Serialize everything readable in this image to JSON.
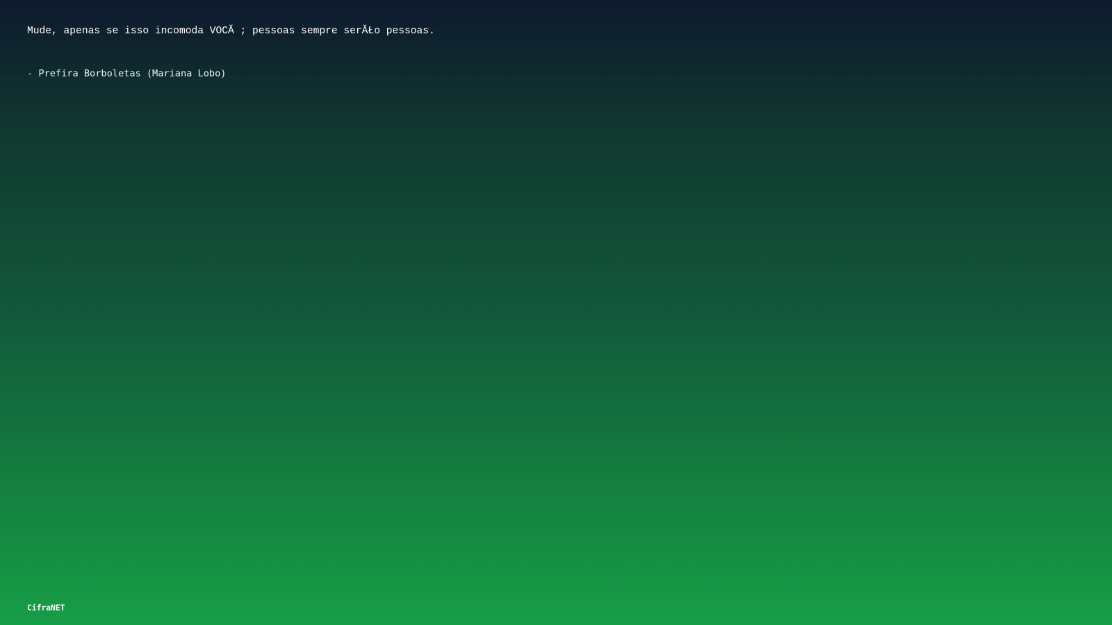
{
  "quote": {
    "text": "Mude, apenas se isso incomoda VOCĂ ; pessoas sempre serĂŁo pessoas.",
    "attribution": "- Prefira Borboletas (Mariana Lobo)"
  },
  "footer": {
    "brand": "CifraNET"
  },
  "colors": {
    "background_top": "#0e1a2e",
    "background_bottom": "#169e47",
    "text": "#ffffff"
  }
}
